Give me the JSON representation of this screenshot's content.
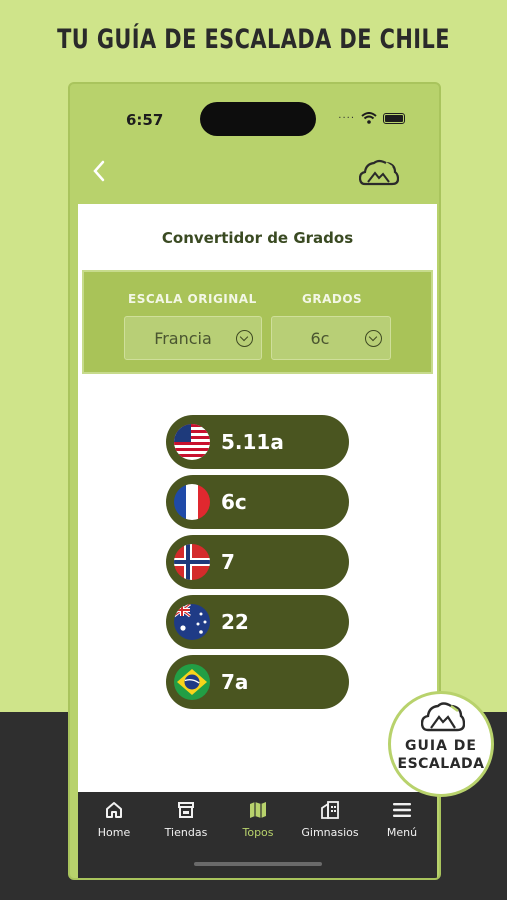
{
  "banner": {
    "headline": "TU GUÍA DE ESCALADA DE CHILE"
  },
  "status_bar": {
    "time": "6:57",
    "signal_dots": "····"
  },
  "header": {
    "back_icon": "chevron-left-icon",
    "logo_icon": "mountain-cloud-logo"
  },
  "page": {
    "title": "Convertidor de Grados"
  },
  "filters": {
    "scale_label": "ESCALA ORIGINAL",
    "grade_label": "GRADOS",
    "scale_value": "Francia",
    "grade_value": "6c"
  },
  "grades": [
    {
      "country": "usa",
      "flag_icon": "us-flag-icon",
      "value": "5.11a"
    },
    {
      "country": "france",
      "flag_icon": "france-flag-icon",
      "value": "6c"
    },
    {
      "country": "norway",
      "flag_icon": "norway-flag-icon",
      "value": "7"
    },
    {
      "country": "australia",
      "flag_icon": "australia-flag-icon",
      "value": "22"
    },
    {
      "country": "brazil",
      "flag_icon": "brazil-flag-icon",
      "value": "7a"
    }
  ],
  "tabbar": {
    "items": [
      {
        "label": "Home",
        "icon": "home-icon",
        "active": false
      },
      {
        "label": "Tiendas",
        "icon": "store-icon",
        "active": false
      },
      {
        "label": "Topos",
        "icon": "map-icon",
        "active": true
      },
      {
        "label": "Gimnasios",
        "icon": "building-icon",
        "active": false
      },
      {
        "label": "Menú",
        "icon": "menu-icon",
        "active": false
      }
    ]
  },
  "badge": {
    "line1": "GUIA DE",
    "line2": "ESCALADA"
  },
  "colors": {
    "brand_green": "#b8d26c",
    "pill_olive": "#4a5520",
    "dark": "#2e2e2e"
  }
}
